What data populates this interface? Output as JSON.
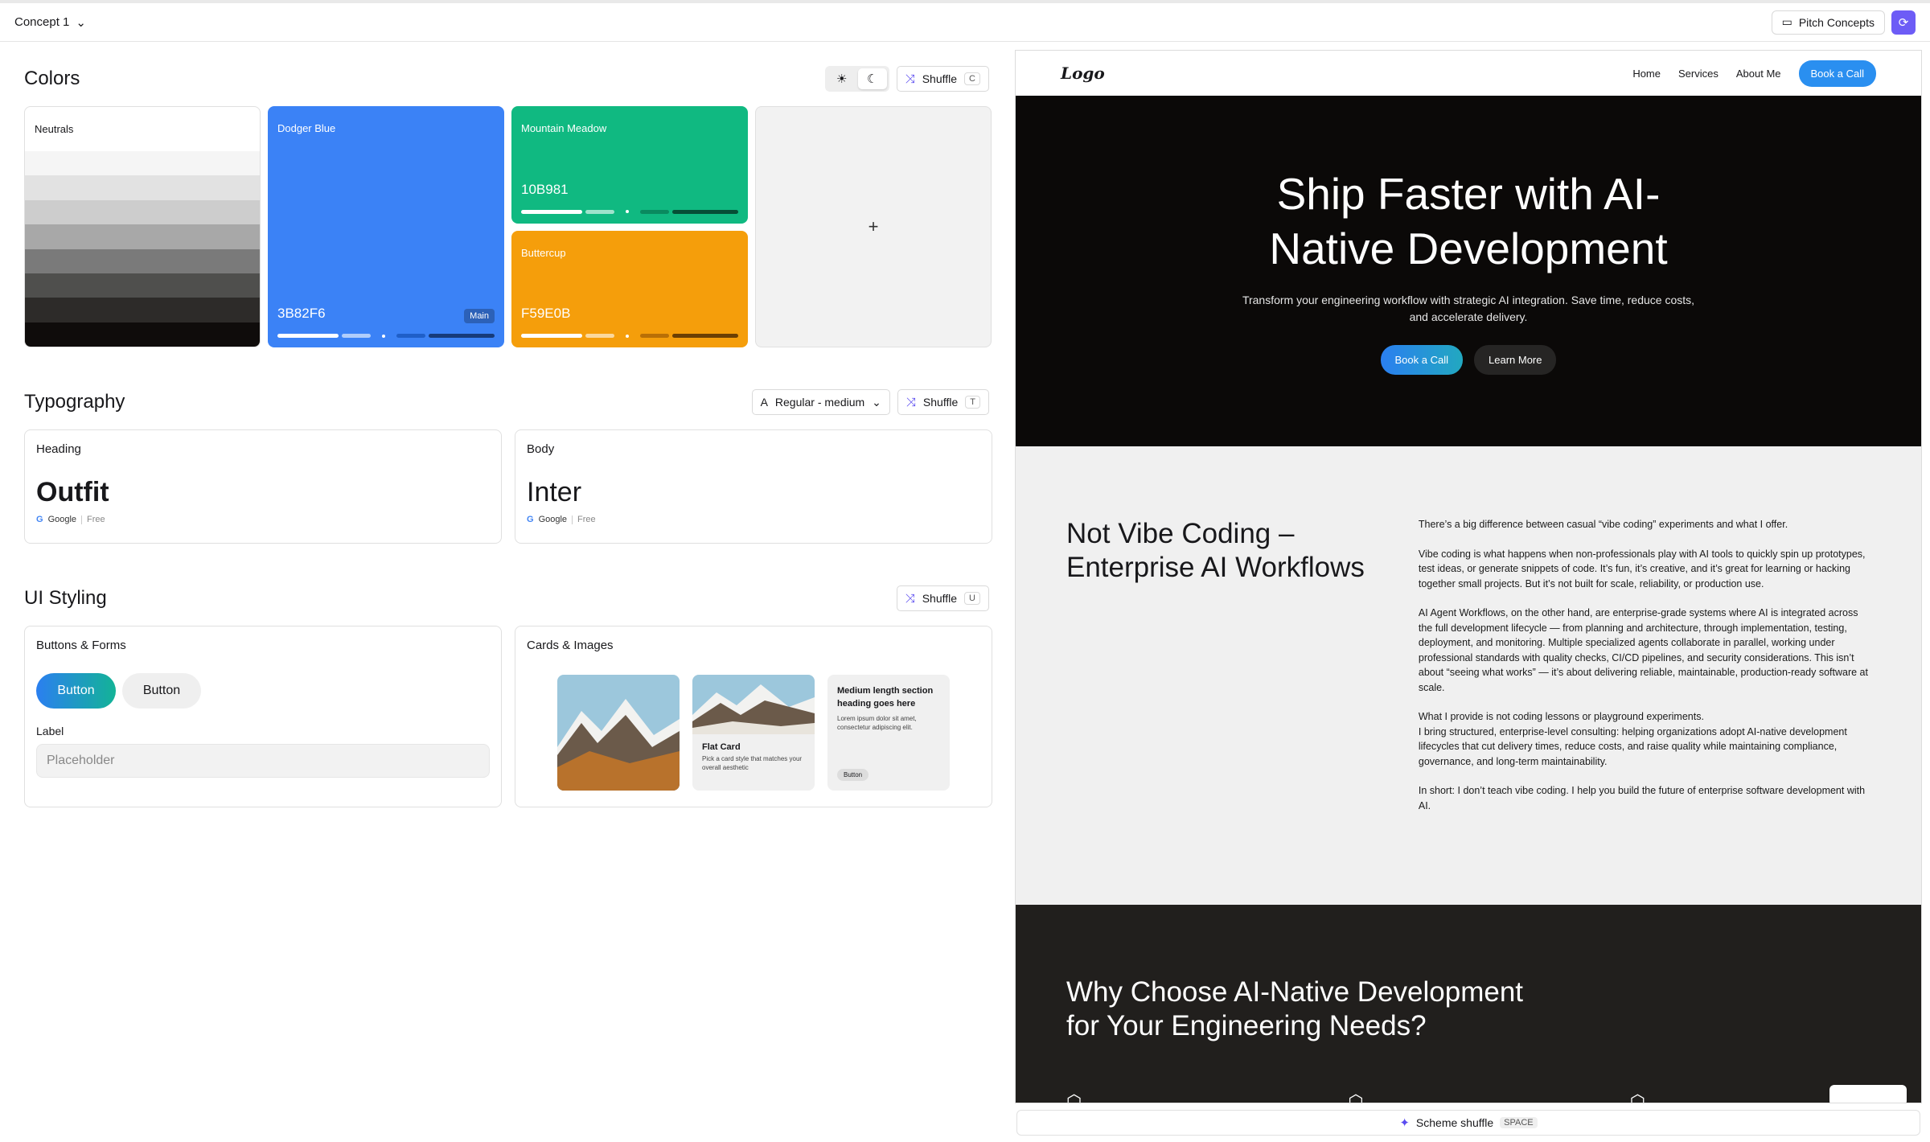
{
  "topbar": {
    "concept": "Concept 1",
    "pitch": "Pitch Concepts"
  },
  "colors": {
    "title": "Colors",
    "shuffle": "Shuffle",
    "shuffle_key": "C",
    "neutrals": {
      "name": "Neutrals",
      "swatches": [
        "#f5f5f5",
        "#e2e2e2",
        "#cdcdcd",
        "#a8a8a8",
        "#7a7a7a",
        "#4f4f4d",
        "#2d2b29",
        "#0f0c0b"
      ]
    },
    "primary": {
      "name": "Dodger Blue",
      "hex": "3B82F6",
      "badge": "Main",
      "color": "#3b82f6"
    },
    "secondary": {
      "name": "Mountain Meadow",
      "hex": "10B981",
      "color": "#10b981"
    },
    "accent": {
      "name": "Buttercup",
      "hex": "F59E0B",
      "color": "#f59e0b"
    },
    "add": "+"
  },
  "typography": {
    "title": "Typography",
    "weight": "Regular - medium",
    "shuffle": "Shuffle",
    "shuffle_key": "T",
    "heading": {
      "label": "Heading",
      "font": "Outfit",
      "provider": "Google",
      "license": "Free"
    },
    "body": {
      "label": "Body",
      "font": "Inter",
      "provider": "Google",
      "license": "Free"
    }
  },
  "ui": {
    "title": "UI Styling",
    "shuffle": "Shuffle",
    "shuffle_key": "U",
    "buttons": {
      "title": "Buttons & Forms",
      "primary": "Button",
      "secondary": "Button",
      "label": "Label",
      "placeholder": "Placeholder"
    },
    "cards": {
      "title": "Cards & Images",
      "flat_title": "Flat Card",
      "flat_desc": "Pick a card style that matches your overall aesthetic",
      "text_title": "Medium length section heading goes here",
      "text_desc": "Lorem ipsum dolor sit amet, consectetur adipiscing elit.",
      "text_button": "Button"
    }
  },
  "preview": {
    "logo": "Logo",
    "nav": [
      "Home",
      "Services",
      "About Me"
    ],
    "nav_cta": "Book a Call",
    "hero_title": "Ship Faster with AI-Native Development",
    "hero_text": "Transform your engineering workflow with strategic AI integration. Save time, reduce costs, and accelerate delivery.",
    "hero_primary": "Book a Call",
    "hero_secondary": "Learn More",
    "s2_title": "Not Vibe Coding – Enterprise AI Workflows",
    "s2_paragraphs": [
      "There’s a big difference between casual “vibe coding” experiments and what I offer.",
      "Vibe coding is what happens when non-professionals play with AI tools to quickly spin up prototypes, test ideas, or generate snippets of code. It’s fun, it’s creative, and it’s great for learning or hacking together small projects. But it’s not built for scale, reliability, or production use.",
      "AI Agent Workflows, on the other hand, are enterprise-grade systems where AI is integrated across the full development lifecycle — from planning and architecture, through implementation, testing, deployment, and monitoring. Multiple specialized agents collaborate in parallel, working under professional standards with quality checks, CI/CD pipelines, and security considerations. This isn’t about “seeing what works” — it’s about delivering reliable, maintainable, production-ready software at scale.",
      "What I provide is not coding lessons or playground experiments.",
      "I bring structured, enterprise-level consulting: helping organizations adopt AI-native development lifecycles that cut delivery times, reduce costs, and raise quality while maintaining compliance, governance, and long-term maintainability.",
      "In short: I don’t teach vibe coding. I help you build the future of enterprise software development with AI."
    ],
    "s3_title": "Why Choose AI-Native Development for Your Engineering Needs?"
  },
  "scheme": {
    "label": "Scheme shuffle",
    "key": "SPACE"
  }
}
